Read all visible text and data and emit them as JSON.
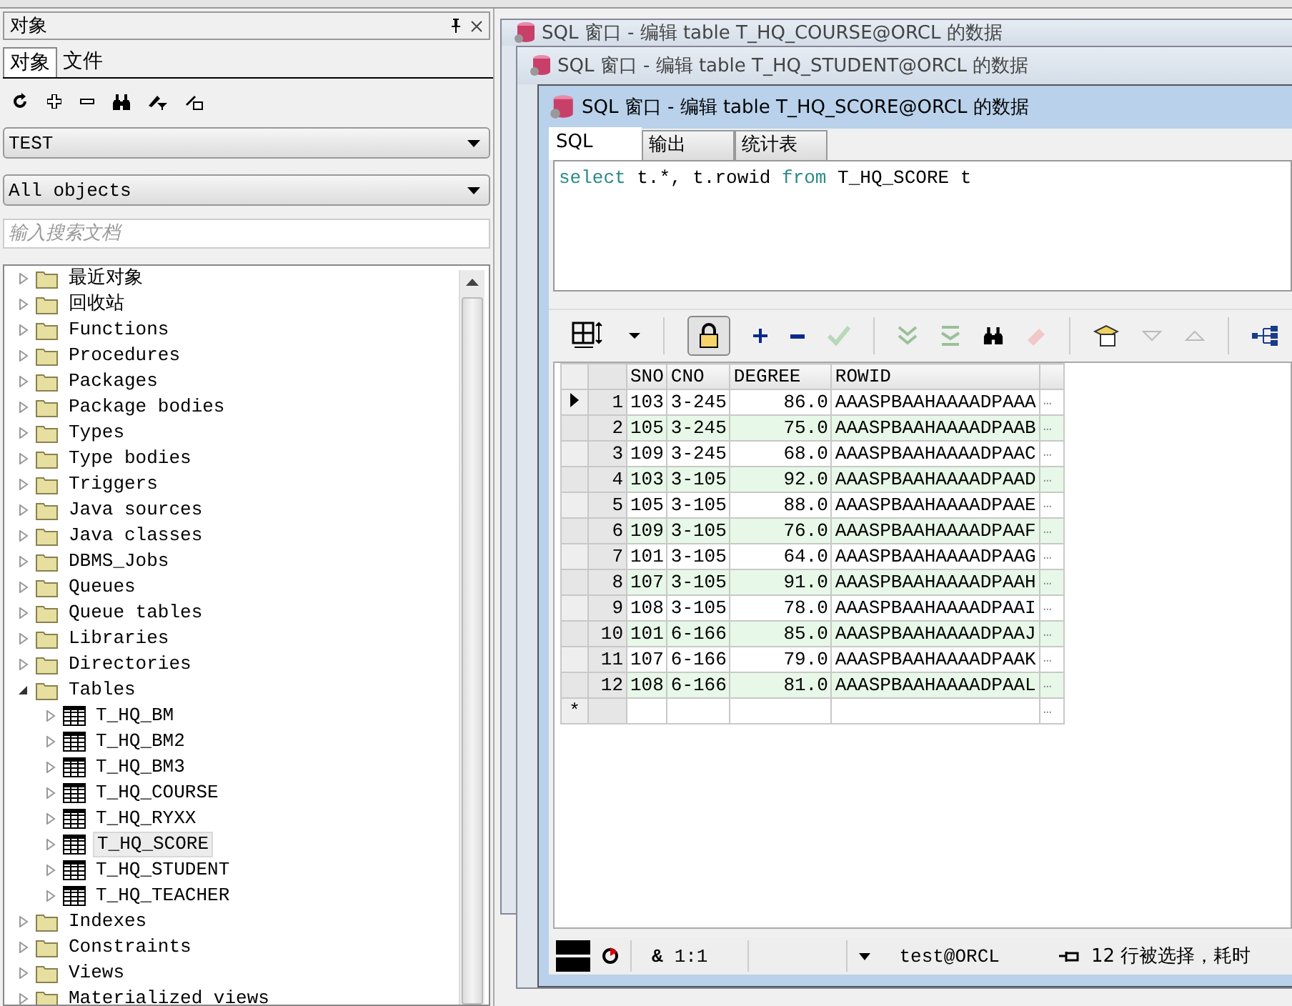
{
  "object_panel": {
    "title": "对象",
    "tabs": [
      {
        "label": "对象",
        "selected": true
      },
      {
        "label": "文件",
        "selected": false
      }
    ],
    "user_select": {
      "value": "TEST"
    },
    "filter_select": {
      "value": "All objects"
    },
    "search": {
      "placeholder": "输入搜索文档"
    },
    "tree": [
      {
        "label": "最近对象",
        "kind": "folder",
        "expanded": false
      },
      {
        "label": "回收站",
        "kind": "folder",
        "expanded": false
      },
      {
        "label": "Functions",
        "kind": "folder",
        "expanded": false
      },
      {
        "label": "Procedures",
        "kind": "folder",
        "expanded": false
      },
      {
        "label": "Packages",
        "kind": "folder",
        "expanded": false
      },
      {
        "label": "Package bodies",
        "kind": "folder",
        "expanded": false
      },
      {
        "label": "Types",
        "kind": "folder",
        "expanded": false
      },
      {
        "label": "Type bodies",
        "kind": "folder",
        "expanded": false
      },
      {
        "label": "Triggers",
        "kind": "folder",
        "expanded": false
      },
      {
        "label": "Java sources",
        "kind": "folder",
        "expanded": false
      },
      {
        "label": "Java classes",
        "kind": "folder",
        "expanded": false
      },
      {
        "label": "DBMS_Jobs",
        "kind": "folder",
        "expanded": false
      },
      {
        "label": "Queues",
        "kind": "folder",
        "expanded": false
      },
      {
        "label": "Queue tables",
        "kind": "folder",
        "expanded": false
      },
      {
        "label": "Libraries",
        "kind": "folder",
        "expanded": false
      },
      {
        "label": "Directories",
        "kind": "folder",
        "expanded": false
      },
      {
        "label": "Tables",
        "kind": "folder",
        "expanded": true,
        "children": [
          {
            "label": "T_HQ_BM",
            "kind": "table",
            "selected": false
          },
          {
            "label": "T_HQ_BM2",
            "kind": "table",
            "selected": false
          },
          {
            "label": "T_HQ_BM3",
            "kind": "table",
            "selected": false
          },
          {
            "label": "T_HQ_COURSE",
            "kind": "table",
            "selected": false
          },
          {
            "label": "T_HQ_RYXX",
            "kind": "table",
            "selected": false
          },
          {
            "label": "T_HQ_SCORE",
            "kind": "table",
            "selected": true
          },
          {
            "label": "T_HQ_STUDENT",
            "kind": "table",
            "selected": false
          },
          {
            "label": "T_HQ_TEACHER",
            "kind": "table",
            "selected": false
          }
        ]
      },
      {
        "label": "Indexes",
        "kind": "folder",
        "expanded": false
      },
      {
        "label": "Constraints",
        "kind": "folder",
        "expanded": false
      },
      {
        "label": "Views",
        "kind": "folder",
        "expanded": false
      },
      {
        "label": "Materialized views",
        "kind": "folder",
        "expanded": false
      }
    ]
  },
  "back_windows": [
    {
      "title": "SQL 窗口 - 编辑 table T_HQ_COURSE@ORCL 的数据"
    },
    {
      "title": "SQL 窗口 - 编辑 table T_HQ_STUDENT@ORCL 的数据"
    }
  ],
  "sql_window": {
    "title": "SQL 窗口 - 编辑 table T_HQ_SCORE@ORCL 的数据",
    "tabs": [
      {
        "label": "SQL",
        "selected": true
      },
      {
        "label": "输出",
        "selected": false
      },
      {
        "label": "统计表",
        "selected": false
      }
    ],
    "query": [
      {
        "text": "select",
        "kind": "keyword"
      },
      {
        "text": " t.*, t.rowid ",
        "kind": "plain"
      },
      {
        "text": "from",
        "kind": "keyword"
      },
      {
        "text": " T_HQ_SCORE t",
        "kind": "plain"
      }
    ],
    "grid": {
      "columns": [
        "SNO",
        "CNO",
        "DEGREE",
        "ROWID"
      ],
      "rows": [
        {
          "num": "1",
          "cells": [
            "103",
            "3-245",
            "86.0",
            "AAASPBAAHAAAADPAAA"
          ],
          "current": true
        },
        {
          "num": "2",
          "cells": [
            "105",
            "3-245",
            "75.0",
            "AAASPBAAHAAAADPAAB"
          ],
          "current": false
        },
        {
          "num": "3",
          "cells": [
            "109",
            "3-245",
            "68.0",
            "AAASPBAAHAAAADPAAC"
          ],
          "current": false
        },
        {
          "num": "4",
          "cells": [
            "103",
            "3-105",
            "92.0",
            "AAASPBAAHAAAADPAAD"
          ],
          "current": false
        },
        {
          "num": "5",
          "cells": [
            "105",
            "3-105",
            "88.0",
            "AAASPBAAHAAAADPAAE"
          ],
          "current": false
        },
        {
          "num": "6",
          "cells": [
            "109",
            "3-105",
            "76.0",
            "AAASPBAAHAAAADPAAF"
          ],
          "current": false
        },
        {
          "num": "7",
          "cells": [
            "101",
            "3-105",
            "64.0",
            "AAASPBAAHAAAADPAAG"
          ],
          "current": false
        },
        {
          "num": "8",
          "cells": [
            "107",
            "3-105",
            "91.0",
            "AAASPBAAHAAAADPAAH"
          ],
          "current": false
        },
        {
          "num": "9",
          "cells": [
            "108",
            "3-105",
            "78.0",
            "AAASPBAAHAAAADPAAI"
          ],
          "current": false
        },
        {
          "num": "10",
          "cells": [
            "101",
            "6-166",
            "85.0",
            "AAASPBAAHAAAADPAAJ"
          ],
          "current": false
        },
        {
          "num": "11",
          "cells": [
            "107",
            "6-166",
            "79.0",
            "AAASPBAAHAAAADPAAK"
          ],
          "current": false
        },
        {
          "num": "12",
          "cells": [
            "108",
            "6-166",
            "81.0",
            "AAASPBAAHAAAADPAAL"
          ],
          "current": false
        }
      ],
      "new_row_marker": "*",
      "cell_button": "…"
    },
    "status_bar": {
      "ampersand": "&",
      "position": "1:1",
      "connection": "test@ORCL",
      "message": "12 行被选择，耗时"
    }
  }
}
